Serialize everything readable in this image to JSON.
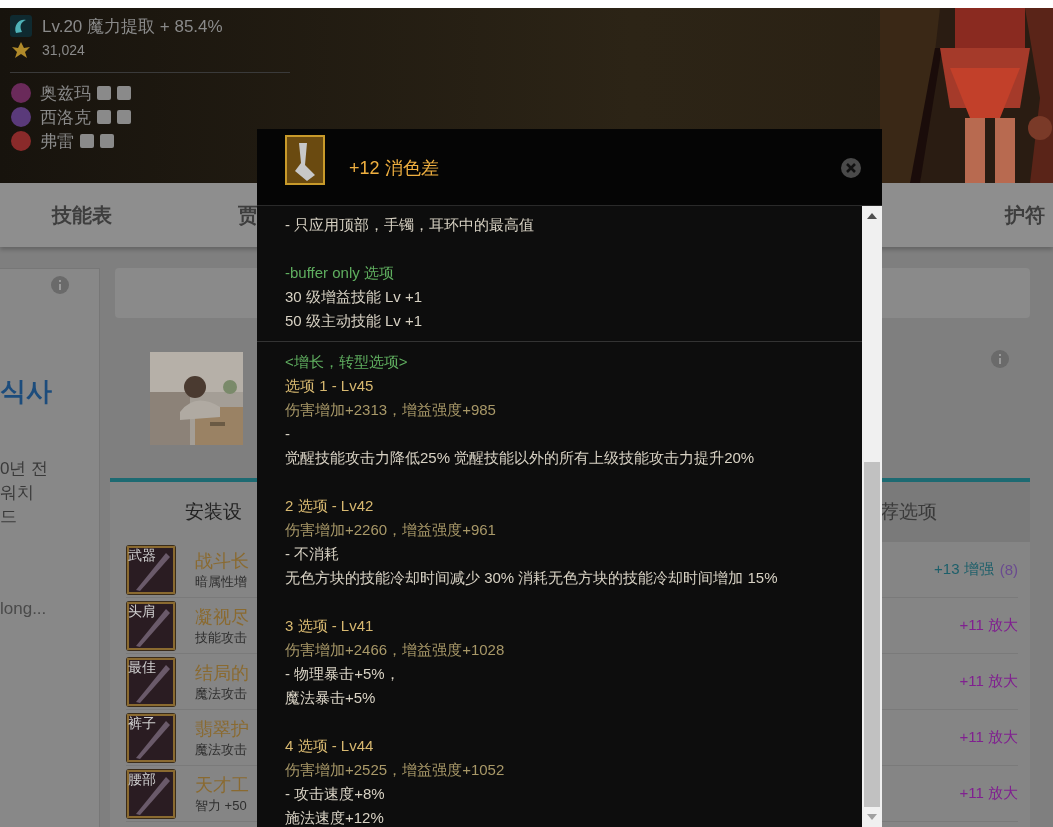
{
  "banner": {
    "skill": "Lv.20 魔力提取 + 85.4%",
    "score": "31,024",
    "members": [
      {
        "name": "奥兹玛",
        "color": "#6a2a5a"
      },
      {
        "name": "西洛克",
        "color": "#5a3a7a"
      },
      {
        "name": "弗雷",
        "color": "#8a2a2a"
      }
    ]
  },
  "nav": [
    {
      "label": "技能表"
    },
    {
      "label": "贾"
    },
    {
      "label": "护符"
    }
  ],
  "sidebar": {
    "title": "식사",
    "lines": [
      "0년 전",
      "워치",
      "드"
    ],
    "more": "long..."
  },
  "equipment": {
    "tabs": [
      {
        "label": "安装设",
        "selected": true
      },
      {
        "label": "荐选项",
        "selected": false
      }
    ],
    "rows": [
      {
        "slot": "武器",
        "name": "战斗长",
        "stat": "暗属性增",
        "kind": "enhance",
        "upgrade": "+13 增强",
        "note": "(8)"
      },
      {
        "slot": "头肩",
        "name": "凝视尽",
        "stat": "技能攻击",
        "kind": "amplify",
        "upgrade": "+11 放大"
      },
      {
        "slot": "最佳",
        "name": "结局的",
        "stat": "魔法攻击",
        "kind": "amplify",
        "upgrade": "+11 放大"
      },
      {
        "slot": "裤子",
        "name": "翡翠护",
        "stat": "魔法攻击",
        "kind": "amplify",
        "upgrade": "+11 放大"
      },
      {
        "slot": "腰部",
        "name": "天才工",
        "stat": "智力 +50",
        "kind": "amplify",
        "upgrade": "+11 放大"
      }
    ]
  },
  "tooltip": {
    "title": "+12 消色差",
    "sections": [
      {
        "groups": [
          {
            "lines": [
              {
                "kind": "text",
                "text": "- 只应用顶部，手镯，耳环中的最高值"
              }
            ]
          },
          {
            "lines": [
              {
                "kind": "heading",
                "text": "-buffer only 选项"
              },
              {
                "kind": "text",
                "text": "30 级增益技能 Lv +1"
              },
              {
                "kind": "text",
                "text": "50 级主动技能 Lv +1"
              }
            ]
          }
        ]
      },
      {
        "groups": [
          {
            "lines": [
              {
                "kind": "heading",
                "text": "<增长，转型选项>"
              },
              {
                "kind": "option",
                "text": "选项 1 - Lv45"
              },
              {
                "kind": "stat",
                "text": "伤害增加+2313，增益强度+985"
              },
              {
                "kind": "text",
                "text": "-"
              },
              {
                "kind": "text",
                "text": "觉醒技能攻击力降低25% 觉醒技能以外的所有上级技能攻击力提升20%"
              }
            ]
          },
          {
            "lines": [
              {
                "kind": "option",
                "text": "2 选项 - Lv42"
              },
              {
                "kind": "stat",
                "text": "伤害增加+2260，增益强度+961"
              },
              {
                "kind": "text",
                "text": "- 不消耗"
              },
              {
                "kind": "text",
                "text": "无色方块的技能冷却时间减少 30% 消耗无色方块的技能冷却时间增加 15%"
              }
            ]
          },
          {
            "lines": [
              {
                "kind": "option",
                "text": "3 选项 - Lv41"
              },
              {
                "kind": "stat",
                "text": "伤害增加+2466，增益强度+1028"
              },
              {
                "kind": "text",
                "text": "- 物理暴击+5%，"
              },
              {
                "kind": "text",
                "text": "魔法暴击+5%"
              }
            ]
          },
          {
            "lines": [
              {
                "kind": "option",
                "text": "4 选项 - Lv44"
              },
              {
                "kind": "stat",
                "text": "伤害增加+2525，增益强度+1052"
              },
              {
                "kind": "text",
                "text": "- 攻击速度+8%"
              },
              {
                "kind": "text",
                "text": "施法速度+12%"
              }
            ]
          }
        ]
      }
    ]
  }
}
